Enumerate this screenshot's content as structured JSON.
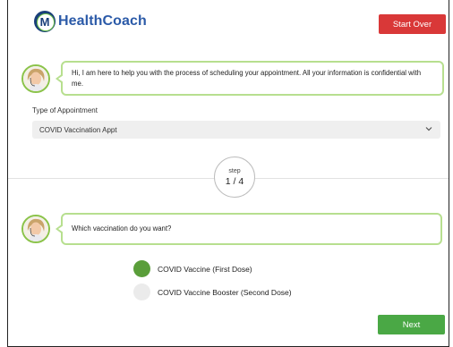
{
  "header": {
    "logo_letter": "M",
    "logo_text": "HealthCoach",
    "start_over_label": "Start Over"
  },
  "coach": {
    "intro_message": "Hi, I am here to help you with the process of scheduling your appointment. All your information is confidential with me.",
    "question_message": "Which vaccination do you want?"
  },
  "appointment": {
    "label": "Type of Appointment",
    "selected_value": "COVID Vaccination Appt"
  },
  "progress": {
    "word": "step",
    "count": "1 / 4",
    "current": 1,
    "total": 4
  },
  "options": [
    {
      "label": "COVID Vaccine (First Dose)",
      "selected": true
    },
    {
      "label": "COVID Vaccine Booster (Second Dose)",
      "selected": false
    }
  ],
  "footer": {
    "next_label": "Next"
  },
  "colors": {
    "brand_blue": "#2b5aa8",
    "start_over": "#d93838",
    "next": "#4aa845",
    "selected_radio": "#5a9e3a",
    "bubble_border": "#b7df8f"
  },
  "icons": {
    "logo": "healthcoach-logo-icon",
    "avatar": "coach-avatar-icon",
    "dropdown": "chevron-down-icon"
  }
}
